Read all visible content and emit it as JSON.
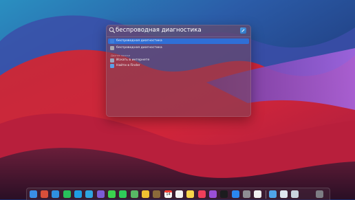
{
  "spotlight": {
    "query": "беспроводная диагностика",
    "results": [
      {
        "label": "беспроводная диагностика",
        "icon": "wireless-diagnostics-icon",
        "color": "#3f7fdc",
        "selected": true
      },
      {
        "label": "беспроводная диагностика",
        "icon": "settings-icon",
        "color": "#a8a8b0",
        "selected": false
      }
    ],
    "section_label": "Другие поиски",
    "actions": [
      {
        "label": "Искать в интернете",
        "icon": "web-search-icon",
        "color": "#9aa8c0"
      },
      {
        "label": "Найти в Finder",
        "icon": "finder-icon",
        "color": "#5aa0e8"
      }
    ]
  },
  "dock": {
    "apps": [
      {
        "name": "finder",
        "color": "#3a8ee6"
      },
      {
        "name": "launchpad",
        "color": "#d94f3a"
      },
      {
        "name": "safari",
        "color": "#2f8fe0"
      },
      {
        "name": "whatsapp",
        "color": "#28c15b"
      },
      {
        "name": "skype",
        "color": "#1e9de3"
      },
      {
        "name": "telegram",
        "color": "#2ea4e0"
      },
      {
        "name": "viber",
        "color": "#7b5cd6"
      },
      {
        "name": "messages",
        "color": "#3bd24f"
      },
      {
        "name": "facetime",
        "color": "#2fcb5a"
      },
      {
        "name": "maps",
        "color": "#58b865"
      },
      {
        "name": "photos",
        "color": "#f1c232"
      },
      {
        "name": "notes-dark",
        "color": "#8a6a3a"
      },
      {
        "name": "calendar",
        "color": "#f5f5f5"
      },
      {
        "name": "reminders",
        "color": "#f2f2f2"
      },
      {
        "name": "notes",
        "color": "#f7d54a"
      },
      {
        "name": "music",
        "color": "#f03e5a"
      },
      {
        "name": "podcasts",
        "color": "#9b4fd8"
      },
      {
        "name": "apple-tv",
        "color": "#1c1c1e"
      },
      {
        "name": "app-store",
        "color": "#2a86f0"
      },
      {
        "name": "system-preferences",
        "color": "#8e8e93"
      },
      {
        "name": "sketchbook",
        "color": "#f0f0f0"
      },
      {
        "name": "downloads",
        "color": "#4fa3e8"
      },
      {
        "name": "screenshot-1",
        "color": "#dfe6ee"
      },
      {
        "name": "screenshot-2",
        "color": "#c9d3de"
      },
      {
        "name": "trash",
        "color": "#7d7d84"
      }
    ],
    "calendar_day": "14"
  }
}
